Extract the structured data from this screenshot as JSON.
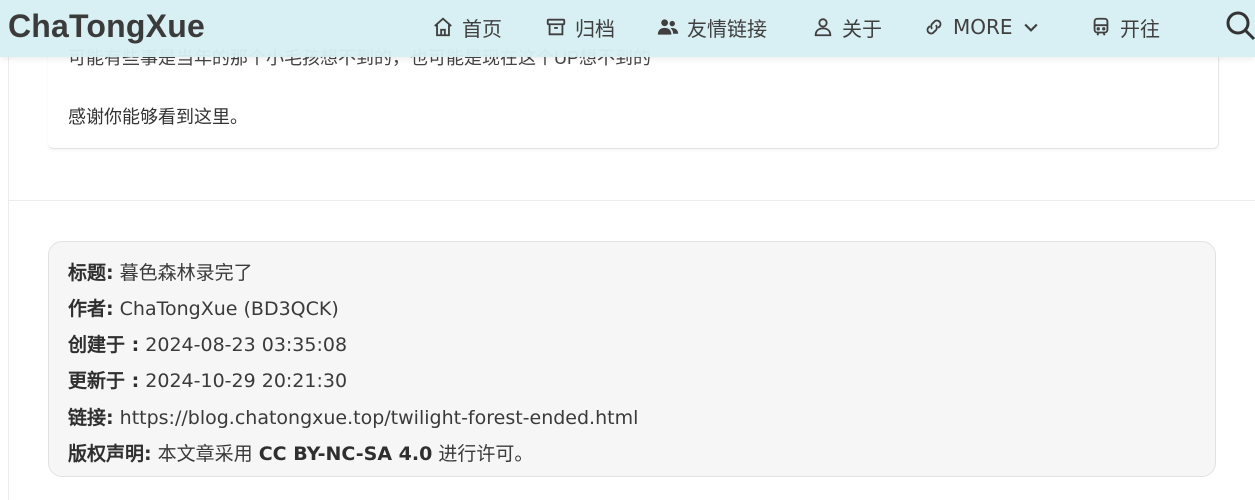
{
  "brand": "ChaTongXue",
  "nav": {
    "home": "首页",
    "archive": "归档",
    "friends": "友情链接",
    "about": "关于",
    "more": "MORE",
    "travel": "开往"
  },
  "post": {
    "partial_line": "可能有些事是当年的那个小毛孩想不到的，也可能是现在这个UP想不到的",
    "closing_line": "感谢你能够看到这里。"
  },
  "copyright": {
    "title_label": "标题:",
    "title_value": "暮色森林录完了",
    "author_label": "作者:",
    "author_value": "ChaTongXue (BD3QCK)",
    "created_label": "创建于 :",
    "created_value": "2024-08-23 03:35:08",
    "updated_label": "更新于 :",
    "updated_value": "2024-10-29 20:21:30",
    "link_label": "链接:",
    "link_value": "https://blog.chatongxue.top/twilight-forest-ended.html",
    "license_label": "版权声明:",
    "license_prefix": "本文章采用",
    "license_name": "CC BY-NC-SA 4.0",
    "license_suffix": "进行许可。"
  },
  "icons": {
    "home": "home-icon",
    "archive": "archive-icon",
    "friends": "users-icon",
    "about": "user-icon",
    "more": "link-icon",
    "more_caret": "chevron-down-icon",
    "travel": "train-icon",
    "search": "search-icon"
  }
}
